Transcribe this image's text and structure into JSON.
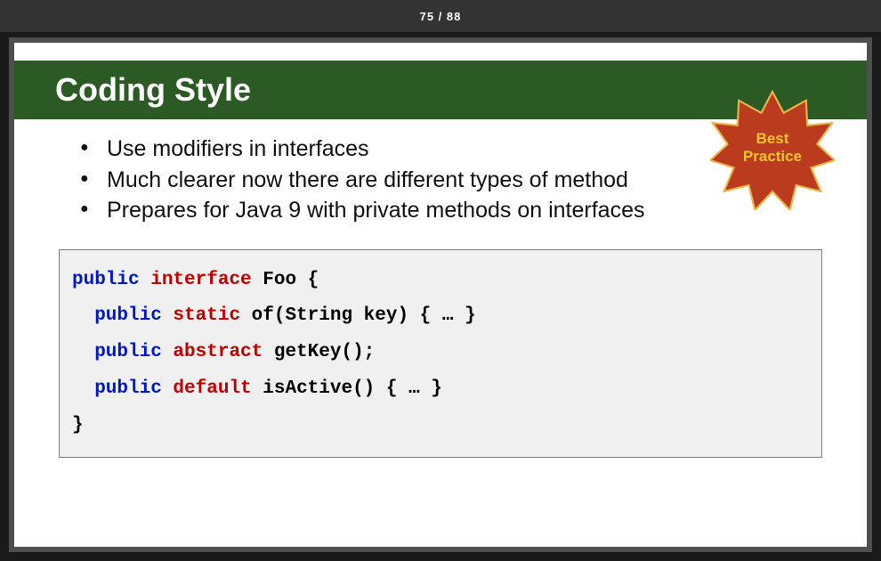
{
  "pager": {
    "current": 75,
    "total": 88,
    "display": "75 / 88"
  },
  "slide": {
    "title": "Coding Style",
    "badge": {
      "line1": "Best",
      "line2": "Practice"
    },
    "bullets": [
      "Use modifiers in interfaces",
      "Much clearer now there are different types of method",
      "Prepares for Java 9 with private methods on interfaces"
    ],
    "code": {
      "l1a": "public",
      "l1b": " interface",
      "l1c": " Foo {",
      "l2a": "  public",
      "l2b": " static",
      "l2c": " of(String key) { … }",
      "l3a": "  public",
      "l3b": " abstract",
      "l3c": " getKey();",
      "l4a": "  public",
      "l4b": " default",
      "l4c": " isActive() { … }",
      "l5": "}"
    }
  },
  "colors": {
    "titleBar": "#2c5a24",
    "starFill": "#bb3b1f",
    "starText": "#f4c430",
    "kwBlue": "#0018c8",
    "kwRed": "#c00000"
  }
}
